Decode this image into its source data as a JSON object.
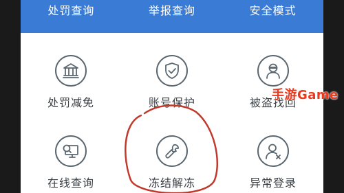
{
  "top_tabs": [
    {
      "label": "处罚查询"
    },
    {
      "label": "举报查询"
    },
    {
      "label": "安全模式"
    }
  ],
  "grid_items": [
    {
      "label": "处罚减免",
      "icon": "courthouse-icon"
    },
    {
      "label": "账号保护",
      "icon": "shield-check-icon"
    },
    {
      "label": "被盗找回",
      "icon": "thief-person-icon"
    },
    {
      "label": "在线查询",
      "icon": "monitor-search-icon"
    },
    {
      "label": "冻结解冻",
      "icon": "wrench-icon"
    },
    {
      "label": "异常登录",
      "icon": "user-warning-icon"
    }
  ],
  "watermark": {
    "text": "手游Game"
  },
  "colors": {
    "top_bar": "#3a7bd5",
    "icon_stroke": "#5b6770",
    "annotation": "#c0392b",
    "watermark": "#e83a1f"
  }
}
